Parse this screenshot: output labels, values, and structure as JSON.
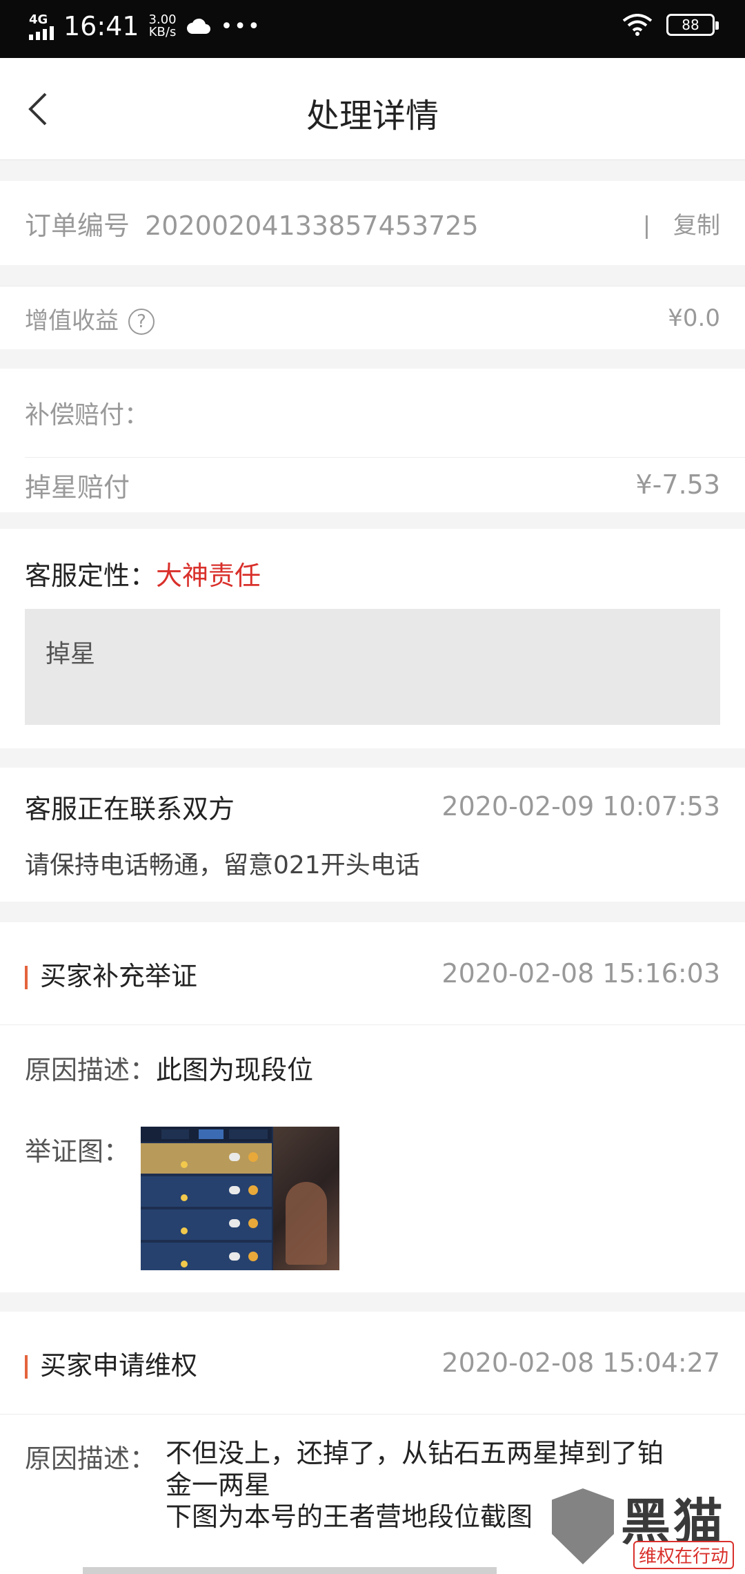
{
  "status_bar": {
    "network": "4G",
    "time": "16:41",
    "speed_value": "3.00",
    "speed_unit": "KB/s",
    "more": "•••",
    "battery": "88"
  },
  "nav": {
    "title": "处理详情"
  },
  "order": {
    "label": "订单编号",
    "number": "20200204133857453725",
    "separator": "|",
    "copy_label": "复制"
  },
  "value_added": {
    "label": "增值收益",
    "help_icon": "?",
    "amount": "¥0.0"
  },
  "compensation": {
    "header": "补偿赔付：",
    "items": [
      {
        "label": "掉星赔付",
        "amount": "¥-7.53"
      }
    ]
  },
  "verdict": {
    "label": "客服定性：",
    "value": "大神责任",
    "value_color": "#d9302b",
    "note": "掉星"
  },
  "events": [
    {
      "title": "客服正在联系双方",
      "time": "2020-02-09 10:07:53",
      "desc": "请保持电话畅通，留意021开头电话"
    },
    {
      "title": "买家补充举证",
      "time": "2020-02-08 15:16:03",
      "reason_label": "原因描述：",
      "reason": "此图为现段位",
      "evidence_label": "举证图："
    },
    {
      "title": "买家申请维权",
      "time": "2020-02-08 15:04:27",
      "reason_label": "原因描述：",
      "reason_lines": [
        "不但没上，还掉了，从钻石五两星掉到了铂",
        "金一两星",
        "下图为本号的王者营地段位截图"
      ]
    }
  ],
  "colors": {
    "accent": "#e4633c",
    "header_bg": "#0a0a0a",
    "page_bg": "#f4f4f4"
  },
  "watermark": {
    "text": "黑猫",
    "sub": "维权在行动"
  }
}
